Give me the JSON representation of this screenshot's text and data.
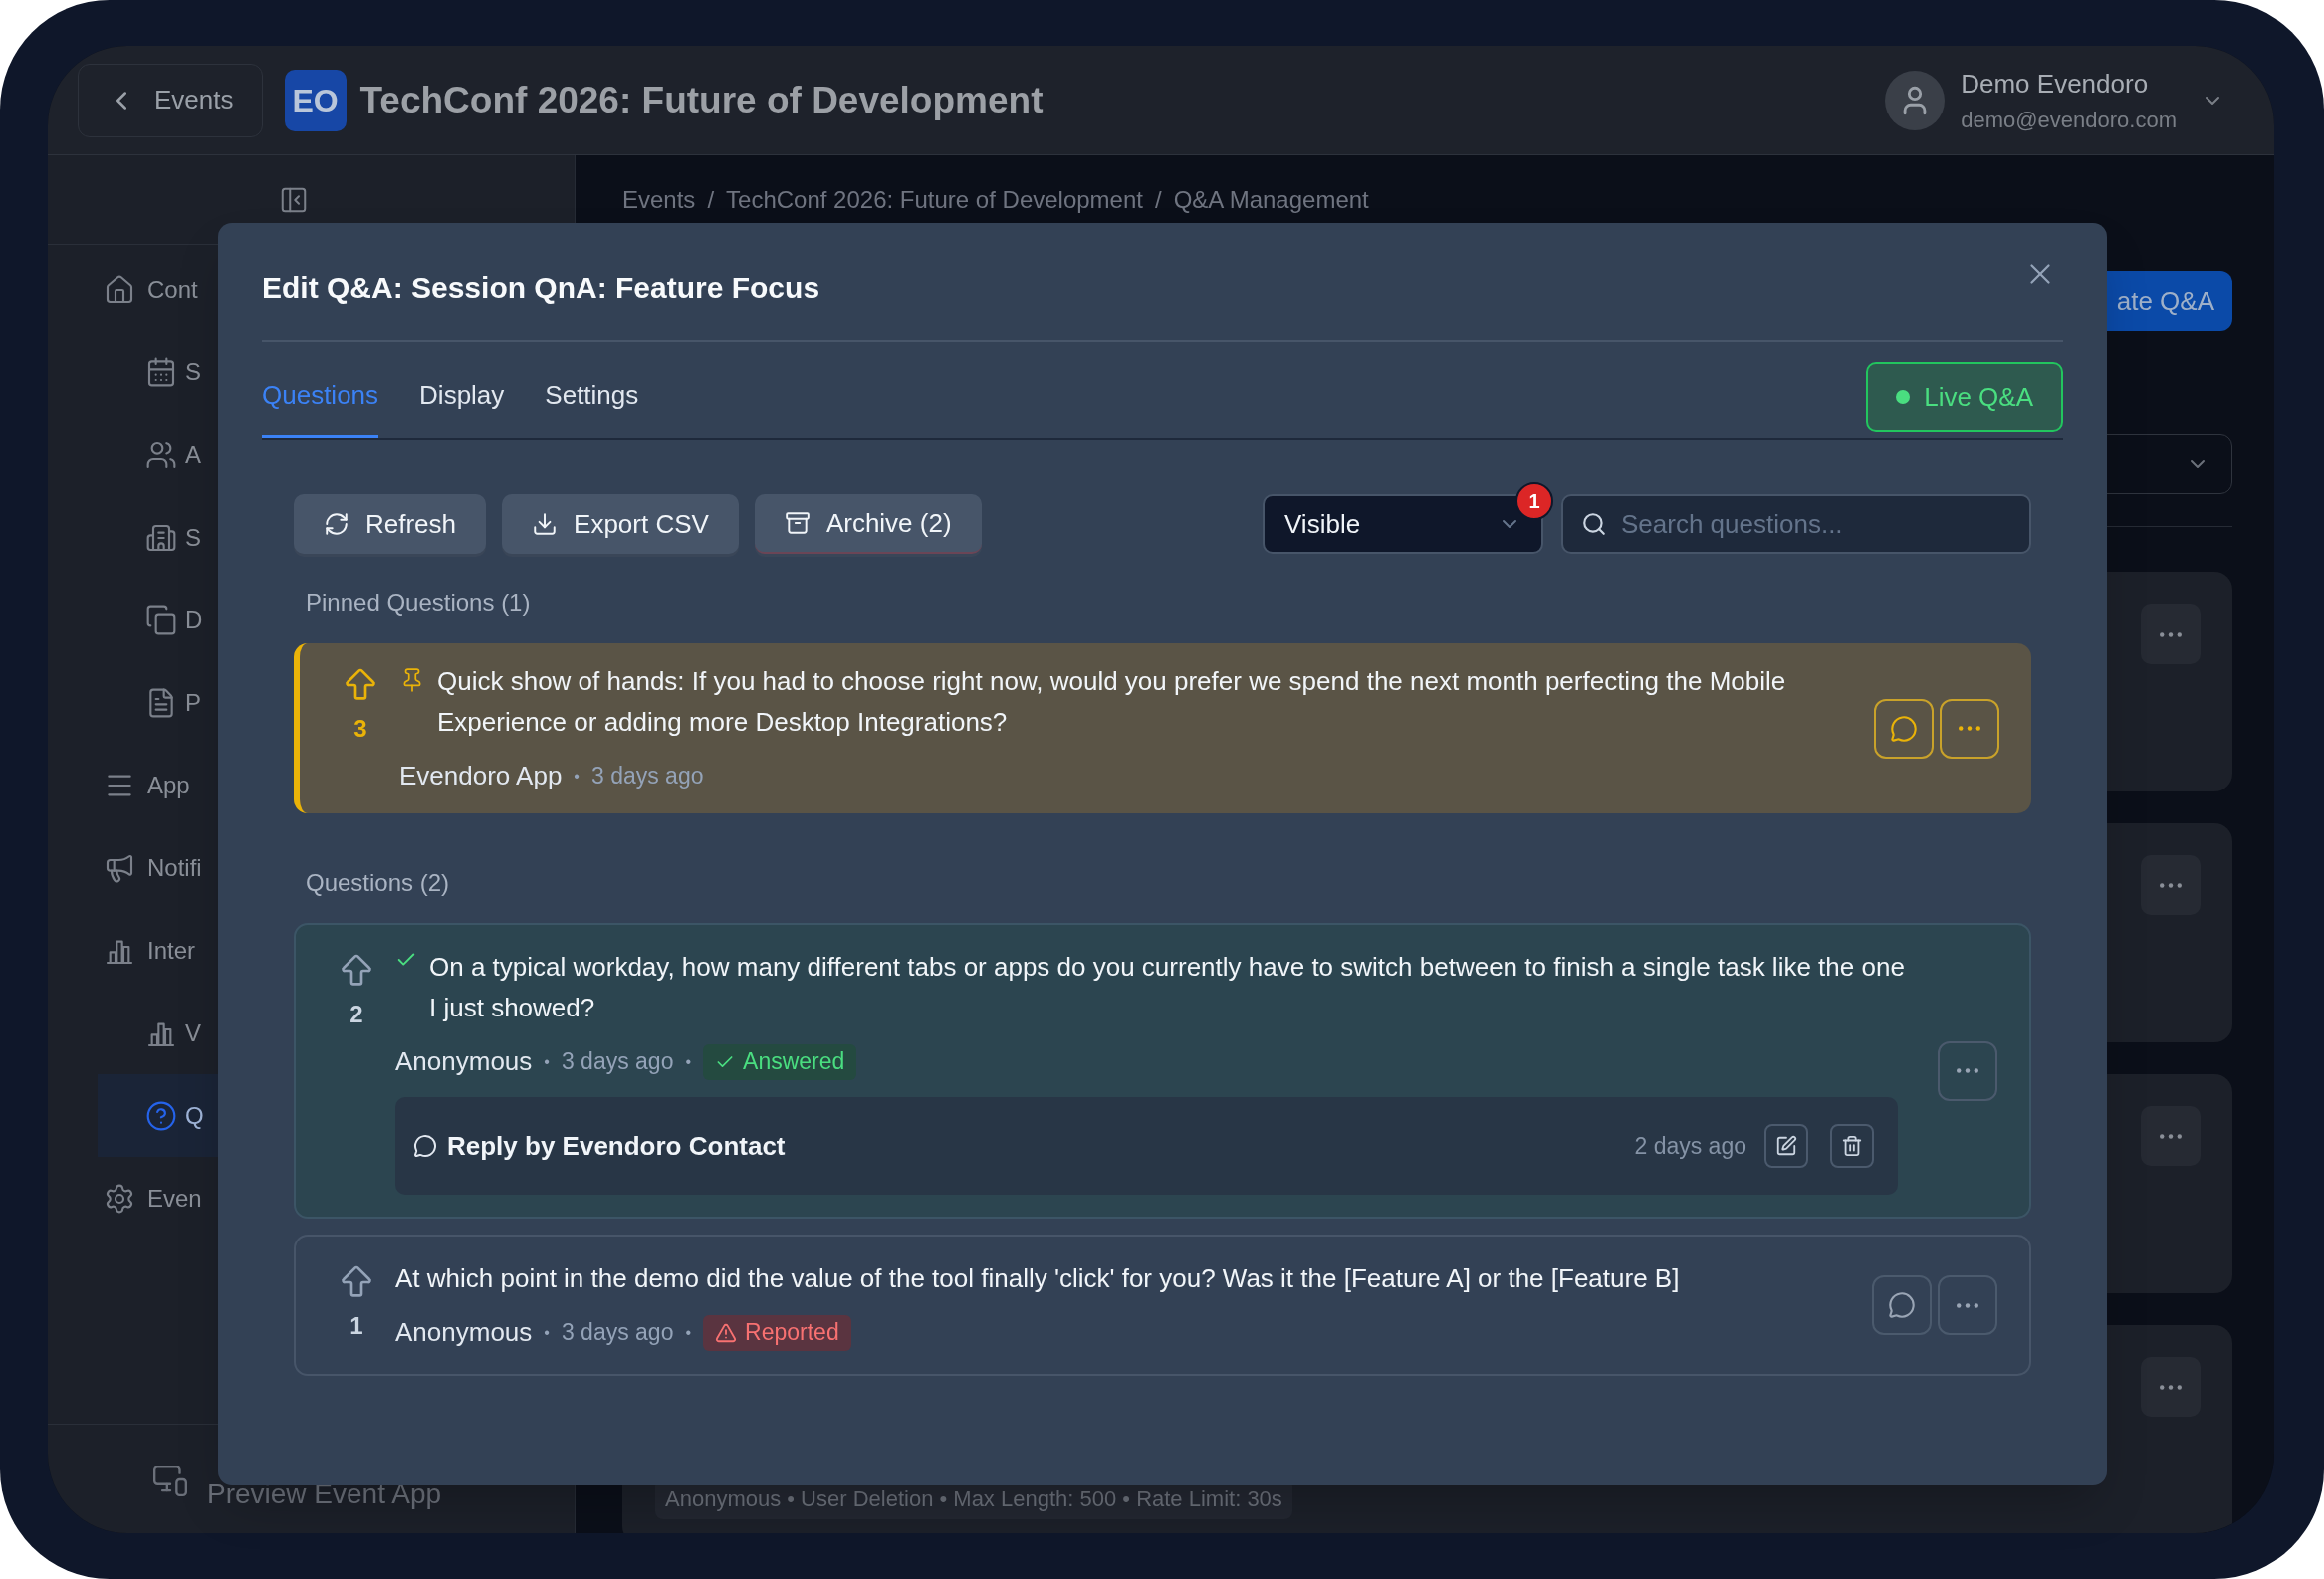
{
  "top_bar": {
    "back_button": "Events",
    "logo": "EO",
    "title": "TechConf 2026: Future of Development",
    "user": {
      "name": "Demo Evendoro",
      "email": "demo@evendoro.com"
    }
  },
  "sidebar": {
    "items": [
      {
        "label": "Cont",
        "selected": false,
        "children": [
          {
            "label": "S",
            "selected": false
          },
          {
            "label": "A",
            "selected": false
          },
          {
            "label": "S",
            "selected": false
          },
          {
            "label": "D",
            "selected": false
          },
          {
            "label": "P",
            "selected": false
          }
        ]
      },
      {
        "label": "App",
        "selected": false
      },
      {
        "label": "Notifi",
        "selected": false
      },
      {
        "label": "Inter",
        "selected": false,
        "children": [
          {
            "label": "V",
            "selected": false
          },
          {
            "label": "Q",
            "selected": true
          }
        ]
      },
      {
        "label": "Even",
        "selected": false
      }
    ],
    "footer": "Preview Event App"
  },
  "page": {
    "breadcrumb": [
      "Events",
      "TechConf 2026: Future of Development",
      "Q&A Management"
    ],
    "breadcrumb_separator": "/",
    "create_button": "ate Q&A",
    "footer_note": "Anonymous • User Deletion • Max Length: 500 • Rate Limit: 30s"
  },
  "modal": {
    "title": "Edit Q&A: Session QnA: Feature Focus",
    "tabs": [
      {
        "label": "Questions",
        "selected": true
      },
      {
        "label": "Display",
        "selected": false
      },
      {
        "label": "Settings",
        "selected": false
      }
    ],
    "live_button": "Live Q&A",
    "toolbar": [
      "Refresh",
      "Export CSV",
      "Archive (2)"
    ],
    "filter": {
      "value": "Visible",
      "badge": "1"
    },
    "search": {
      "placeholder": "Search questions..."
    },
    "meta_separator": "•",
    "sections": [
      {
        "heading": "Pinned Questions (1)",
        "questions": [
          {
            "kind": "pinned",
            "votes": "3",
            "text": "Quick show of hands: If you had to choose right now, would you prefer we spend the next month perfecting the Mobile Experience or adding more Desktop Integrations?",
            "author": "Evendoro App",
            "time": "3 days ago"
          }
        ]
      },
      {
        "heading": "Questions (2)",
        "questions": [
          {
            "kind": "answered",
            "votes": "2",
            "text": "On a typical workday, how many different tabs or apps do you currently have to switch between to finish a single task like the one I just showed?",
            "author": "Anonymous",
            "time": "3 days ago",
            "badge": "Answered",
            "reply": {
              "title": "Reply by Evendoro Contact",
              "time": "2 days ago"
            }
          },
          {
            "kind": "reported",
            "votes": "1",
            "text": "At which point in the demo did the value of the tool finally 'click' for you? Was it the [Feature A] or the [Feature B]",
            "author": "Anonymous",
            "time": "3 days ago",
            "badge": "Reported"
          }
        ]
      }
    ]
  }
}
